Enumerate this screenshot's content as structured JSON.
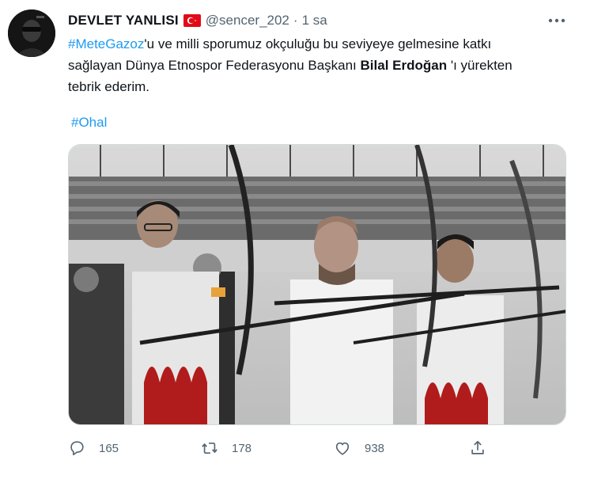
{
  "tweet": {
    "author_name": "DEVLET YANLISI",
    "handle": "@sencer_202",
    "separator": "·",
    "time": "1 sa",
    "text_line1_hashtag": "#MeteGazoz",
    "text_line1_rest": "'u ve milli sporumuz okçuluğu bu seviyeye gelmesine katkı",
    "text_line2_start": "sağlayan Dünya Etnospor Federasyonu Başkanı ",
    "text_line2_bold": "Bilal Erdoğan",
    "text_line2_end": " 'ı yürekten",
    "text_line3": "tebrik ederim.",
    "hashtag2": "#Ohal"
  },
  "actions": {
    "reply_count": "165",
    "retweet_count": "178",
    "like_count": "938"
  },
  "icons": {
    "flag": "turkey-flag-icon",
    "more": "more-dots-icon",
    "reply": "reply-icon",
    "retweet": "retweet-icon",
    "like": "heart-icon",
    "share": "share-icon"
  },
  "colors": {
    "link": "#1d9bf0",
    "secondary": "#536471",
    "text": "#0f1419",
    "flag_red": "#e30a17"
  }
}
